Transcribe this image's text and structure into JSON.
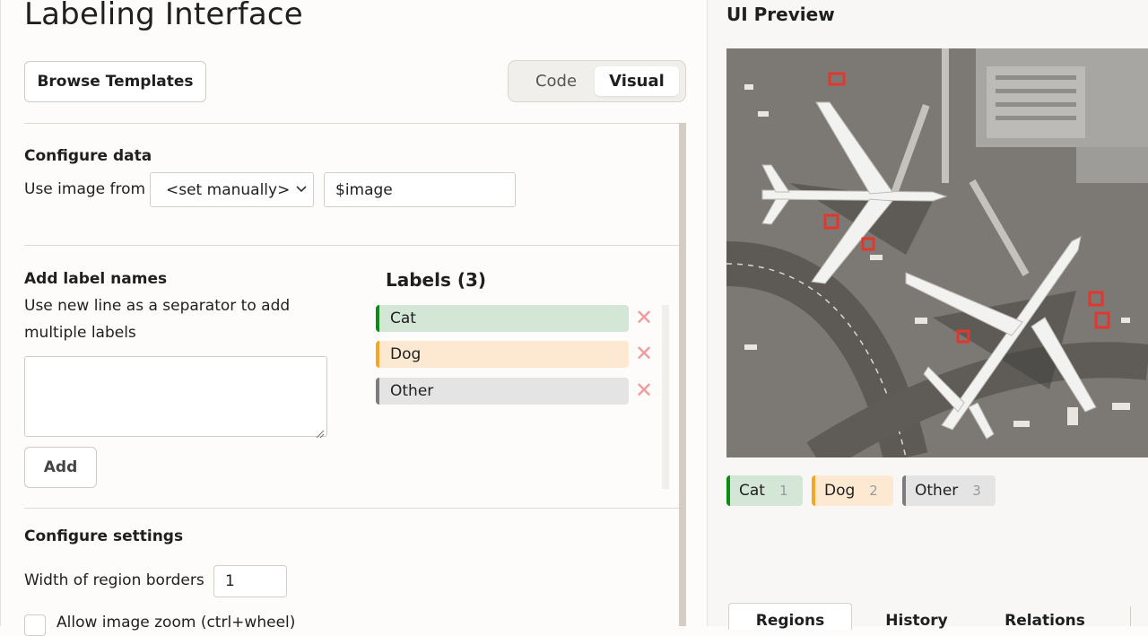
{
  "header": {
    "title": "Labeling Interface"
  },
  "toolbar": {
    "browse_label": "Browse Templates",
    "view_toggle": {
      "code_label": "Code",
      "visual_label": "Visual",
      "active": "Visual"
    }
  },
  "configure_data": {
    "title": "Configure data",
    "use_image_label": "Use image from",
    "source_select_value": "<set manually>",
    "variable_value": "$image"
  },
  "add_labels": {
    "title": "Add label names",
    "hint_line1": "Use new line as a separator to add",
    "hint_line2": "multiple labels",
    "textarea_value": "",
    "add_label": "Add"
  },
  "labels": {
    "heading": "Labels (3)",
    "items": [
      {
        "name": "Cat",
        "color": "#0e8a16",
        "bg": "#d4e6d5"
      },
      {
        "name": "Dog",
        "color": "#f5a623",
        "bg": "#fde9d2"
      },
      {
        "name": "Other",
        "color": "#7c7c7c",
        "bg": "#e4e4e4"
      }
    ]
  },
  "configure_settings": {
    "title": "Configure settings",
    "border_width_label": "Width of region borders",
    "border_width_value": "1",
    "zoom_label": "Allow image zoom (ctrl+wheel)"
  },
  "preview": {
    "title": "UI Preview",
    "chips": [
      {
        "name": "Cat",
        "hotkey": "1",
        "color": "#0e8a16",
        "bg": "#d4e6d5"
      },
      {
        "name": "Dog",
        "hotkey": "2",
        "color": "#f5a623",
        "bg": "#fde9d2"
      },
      {
        "name": "Other",
        "hotkey": "3",
        "color": "#7c7c7c",
        "bg": "#e4e4e4"
      }
    ],
    "tabs": [
      "Regions",
      "History",
      "Relations"
    ]
  }
}
